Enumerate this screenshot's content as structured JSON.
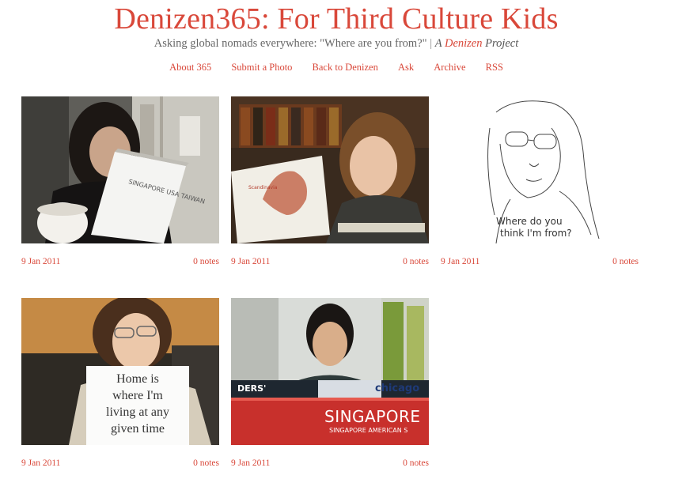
{
  "header": {
    "title": "Denizen365: For Third Culture Kids",
    "tagline_main": "Asking global nomads everywhere: \"Where are you from?\"",
    "tagline_sep": "|",
    "tagline_a": "A",
    "tagline_link": "Denizen",
    "tagline_project": "Project"
  },
  "nav": [
    "About 365",
    "Submit a Photo",
    "Back to Denizen",
    "Ask",
    "Archive",
    "RSS"
  ],
  "posts": [
    {
      "date": "9 Jan 2011",
      "notes": "0 notes",
      "book_text": "SINGAPORE USA TAIWAN"
    },
    {
      "date": "9 Jan 2011",
      "notes": "0 notes",
      "map_label": "Scandinavia"
    },
    {
      "date": "9 Jan 2011",
      "notes": "0 notes",
      "sketch_text_1": "Where do you",
      "sketch_text_2": "think I'm from?"
    },
    {
      "date": "9 Jan 2011",
      "notes": "0 notes",
      "sign_lines": [
        "Home is",
        "where I'm",
        "living at any",
        "given time"
      ]
    },
    {
      "date": "9 Jan 2011",
      "notes": "0 notes",
      "book_spine_1": "DERS'",
      "book_spine_2": "chicago",
      "book_spine_3": "SINGAPORE",
      "book_spine_4": "SINGAPORE AMERICAN S"
    }
  ],
  "colors": {
    "accent": "#d9483a"
  }
}
